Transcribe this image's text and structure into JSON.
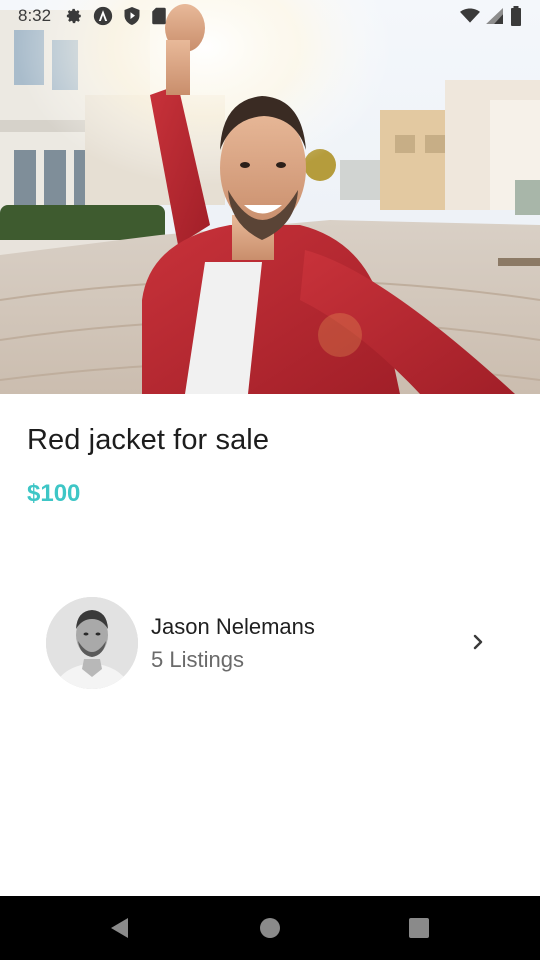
{
  "status_bar": {
    "time": "8:32",
    "icons_left": [
      "gear-icon",
      "app-a-icon",
      "play-protect-icon",
      "sd-card-icon"
    ],
    "icons_right": [
      "wifi-icon",
      "signal-icon",
      "battery-icon"
    ]
  },
  "listing": {
    "title": "Red jacket for sale",
    "price": "$100",
    "image_alt": "Man in red jacket taking a selfie"
  },
  "seller": {
    "name": "Jason Nelemans",
    "listings": "5 Listings"
  },
  "nav": {
    "back": "back-icon",
    "home": "home-icon",
    "recents": "recents-icon"
  },
  "colors": {
    "price": "#3ec6c6",
    "title": "#1d1d1d",
    "nav_bg": "#000000"
  }
}
